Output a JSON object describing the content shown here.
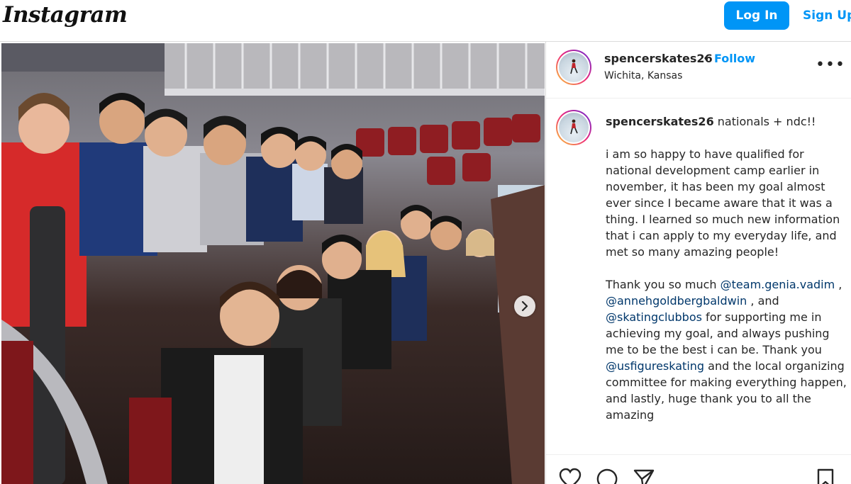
{
  "header": {
    "logo": "Instagram",
    "login_label": "Log In",
    "signup_label": "Sign Up"
  },
  "post": {
    "username": "spencerskates26",
    "separator": "•",
    "follow_label": "Follow",
    "location": "Wichita, Kansas",
    "more_label": "•••",
    "caption": {
      "username": "spencerskates26",
      "line_first": " nationals + ndc!!",
      "para1": "i am so happy to have qualified for national development camp earlier in november, it has been my goal almost ever since I became aware that it was a thing. I learned so much new information that i can apply to my everyday life, and met so many amazing people!",
      "thanks1": "Thank you so much ",
      "mention1": "@team.genia.vadim",
      "sep1": " , ",
      "mention2": "@annehgoldbergbaldwin",
      "sep2": " , and ",
      "mention3": "@skatingclubbos",
      "text3": " for supporting me in achieving my goal, and always pushing me to be the best i can be. Thank you ",
      "mention4": "@usfigureskating",
      "text4": " and the local organizing committee for making everything happen, and lastly, huge thank you to all the amazing"
    }
  },
  "icons": {
    "next": "chevron-right-icon",
    "like": "heart-icon",
    "comment": "comment-icon",
    "share": "send-icon",
    "save": "bookmark-icon"
  },
  "colors": {
    "accent": "#0095f6",
    "mention": "#00376b"
  }
}
